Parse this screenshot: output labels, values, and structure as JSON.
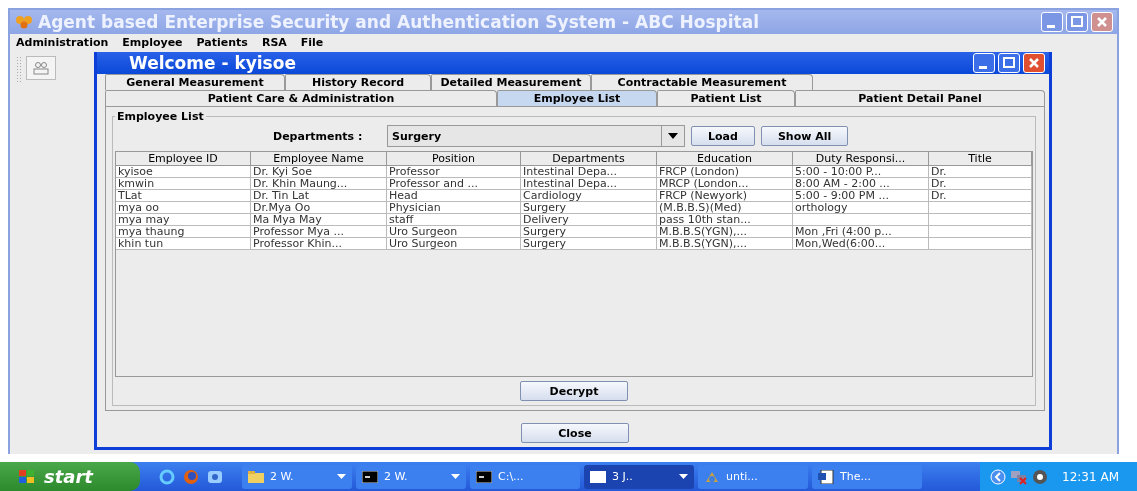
{
  "window": {
    "title": "Agent based Enterprise Security and Authentication System - ABC Hospital"
  },
  "menu": [
    "Administration",
    "Employee",
    "Patients",
    "RSA",
    "File"
  ],
  "inner_window": {
    "title": "Welcome - kyisoe"
  },
  "tabs_back": [
    {
      "label": "General Measurement",
      "selected": false
    },
    {
      "label": "History Record",
      "selected": false
    },
    {
      "label": "Detailed Measurement",
      "selected": false
    },
    {
      "label": "Contractable Measurement",
      "selected": false
    }
  ],
  "tabs_front": [
    {
      "label": "Patient Care & Administration",
      "selected": false
    },
    {
      "label": "Employee List",
      "selected": true
    },
    {
      "label": "Patient List",
      "selected": false
    },
    {
      "label": "Patient Detail Panel",
      "selected": false
    }
  ],
  "panel": {
    "title": "Employee List",
    "departments_label": "Departments :",
    "departments_value": "Surgery",
    "buttons": [
      "Load",
      "Show All"
    ]
  },
  "table": {
    "columns": [
      "Employee ID",
      "Employee Name",
      "Position",
      "Departments",
      "Education",
      "Duty Responsi...",
      "Title"
    ],
    "rows": [
      [
        "kyisoe",
        "Dr. Kyi Soe",
        "Professor",
        "Intestinal Depa...",
        "FRCP (London)",
        "5:00 - 10:00 P...",
        "Dr."
      ],
      [
        "kmwin",
        "Dr. Khin Maung...",
        "Professor and ...",
        "Intestinal Depa...",
        "MRCP (London...",
        "8:00 AM - 2:00 ...",
        "Dr."
      ],
      [
        "TLat",
        "Dr. Tin Lat",
        "Head",
        "Cardiology",
        "FRCP (Newyork)",
        "5:00 - 9:00 PM ...",
        "Dr."
      ],
      [
        "mya oo",
        "Dr.Mya Oo",
        "Physician",
        "Surgery",
        "(M.B.B.S)(Med)",
        "orthology",
        ""
      ],
      [
        "mya may",
        "Ma Mya May",
        "staff",
        "Delivery",
        "pass 10th stan...",
        "",
        ""
      ],
      [
        "mya thaung",
        "Professor Mya ...",
        "Uro Surgeon",
        "Surgery",
        "M.B.B.S(YGN),...",
        "Mon ,Fri (4:00 p...",
        ""
      ],
      [
        "khin tun",
        "Professor Khin...",
        "Uro Surgeon",
        "Surgery",
        "M.B.B.S(YGN),...",
        "Mon,Wed(6:00...",
        ""
      ]
    ]
  },
  "decrypt_button": "Decrypt",
  "close_button": "Close",
  "taskbar": {
    "start": "start",
    "tasks": [
      {
        "label": "2 W.",
        "kind": "folder",
        "has_menu": true,
        "selected": false
      },
      {
        "label": "2 W.",
        "kind": "console",
        "has_menu": true,
        "selected": false
      },
      {
        "label": "C:\\...",
        "kind": "console",
        "has_menu": false,
        "selected": false
      },
      {
        "label": "3 J..",
        "kind": "window",
        "has_menu": true,
        "selected": true
      },
      {
        "label": "unti...",
        "kind": "paint",
        "has_menu": false,
        "selected": false
      },
      {
        "label": "The...",
        "kind": "document",
        "has_menu": false,
        "selected": false
      }
    ],
    "clock": "12:31 AM"
  }
}
